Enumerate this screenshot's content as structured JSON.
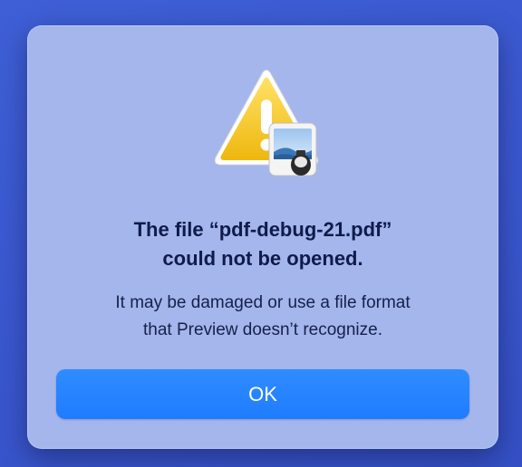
{
  "dialog": {
    "title_line1": "The file “pdf-debug-21.pdf”",
    "title_line2": "could not be opened.",
    "message_line1": "It may be damaged or use a file format",
    "message_line2": "that Preview doesn’t recognize.",
    "ok_label": "OK",
    "icon": "warning-triangle-icon",
    "badge_icon": "preview-app-icon"
  },
  "colors": {
    "desktop": "#3a57cf",
    "dialog_bg": "#a4b6ec",
    "button": "#1f7cff",
    "title_text": "#0f1b4a",
    "warning_yellow": "#f2c218"
  }
}
